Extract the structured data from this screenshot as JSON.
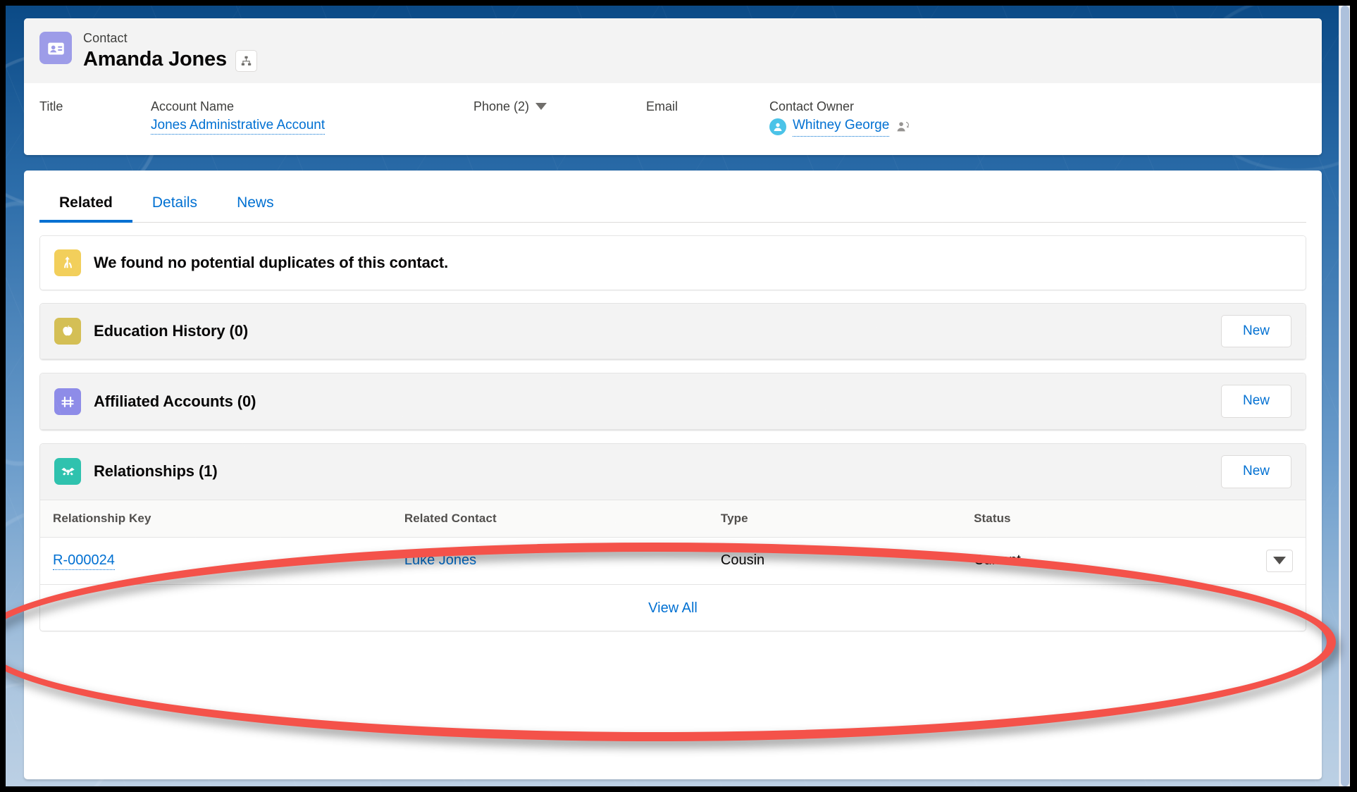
{
  "highlights": {
    "entity_type": "Contact",
    "record_name": "Amanda Jones",
    "entity_icon": "contact-id-card-icon",
    "hierarchy_icon": "hierarchy-icon",
    "entity_icon_color": "#9d9ce8",
    "fields": [
      {
        "label": "Title",
        "value": ""
      },
      {
        "label": "Account Name",
        "value": "Jones Administrative Account",
        "is_link": true
      },
      {
        "label": "Phone (2)",
        "value": "",
        "has_dropdown": true
      },
      {
        "label": "Email",
        "value": ""
      },
      {
        "label": "Contact Owner",
        "value": "Whitney George",
        "is_link": true,
        "has_avatar": true,
        "has_change_owner": true
      }
    ]
  },
  "tabs": [
    {
      "label": "Related",
      "active": true
    },
    {
      "label": "Details",
      "active": false
    },
    {
      "label": "News",
      "active": false
    }
  ],
  "duplicates": {
    "icon": "merge-duplicates-icon",
    "icon_color": "#f2cf5b",
    "message": "We found no potential duplicates of this contact."
  },
  "related_lists": [
    {
      "id": "education-history",
      "title": "Education History (0)",
      "icon": "apple-education-icon",
      "icon_color": "#d4bf55",
      "new_label": "New",
      "has_table": false
    },
    {
      "id": "affiliated-accounts",
      "title": "Affiliated Accounts (0)",
      "icon": "bridge-affiliation-icon",
      "icon_color": "#8e8ce8",
      "new_label": "New",
      "has_table": false
    },
    {
      "id": "relationships",
      "title": "Relationships (1)",
      "icon": "handshake-relationship-icon",
      "icon_color": "#2fc2ae",
      "new_label": "New",
      "has_table": true
    }
  ],
  "relationships_table": {
    "columns": [
      "Relationship Key",
      "Related Contact",
      "Type",
      "Status"
    ],
    "rows": [
      {
        "relationship_key": "R-000024",
        "related_contact": "Luke Jones",
        "type": "Cousin",
        "status": "Current"
      }
    ],
    "footer_link": "View All",
    "row_action_icon": "chevron-down-icon"
  },
  "colors": {
    "link_blue": "#0070d2",
    "annotation_red": "#f4524a",
    "active_tab_underline": "#0070d2"
  }
}
